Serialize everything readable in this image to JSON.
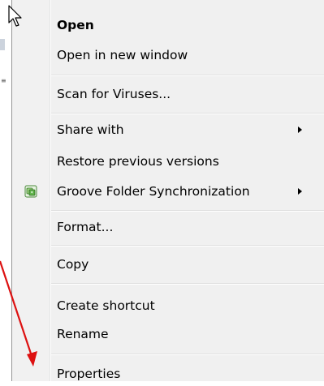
{
  "menu": {
    "items": [
      {
        "label": "Open",
        "bold": true
      },
      {
        "label": "Open in new window"
      },
      {
        "label": "Scan for Viruses..."
      },
      {
        "label": "Share with",
        "submenu": true
      },
      {
        "label": "Restore previous versions"
      },
      {
        "label": "Groove Folder Synchronization",
        "submenu": true,
        "icon": "groove-sync-icon"
      },
      {
        "label": "Format..."
      },
      {
        "label": "Copy"
      },
      {
        "label": "Create shortcut"
      },
      {
        "label": "Rename"
      },
      {
        "label": "Properties"
      }
    ]
  },
  "colors": {
    "menu_bg": "#f0f0f0",
    "annotation_arrow": "#dd1111",
    "groove_icon": "#3a9a3a"
  }
}
